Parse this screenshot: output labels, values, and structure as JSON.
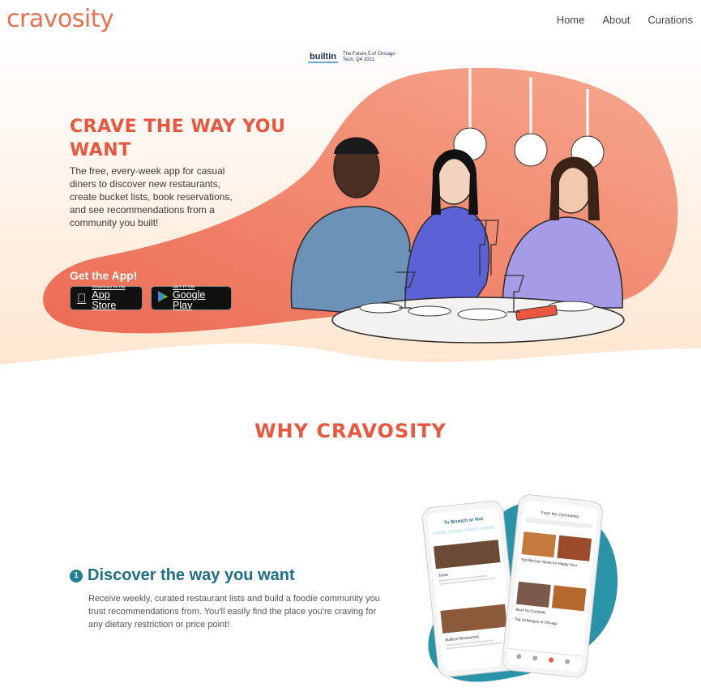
{
  "header": {
    "logo": "cravosity",
    "nav": [
      "Home",
      "About",
      "Curations"
    ]
  },
  "award": {
    "logo": "builtin",
    "text": "The Future 5 of Chicago Tech, Q4 2021"
  },
  "hero": {
    "title": "CRAVE THE WAY YOU WANT",
    "description": "The free, every-week app for casual diners to discover new restaurants, create bucket lists, book reservations, and see recommendations from a community you built!",
    "get_app": "Get the App!",
    "app_store": {
      "small": "Download on the",
      "big": "App Store"
    },
    "google_play": {
      "small": "GET IT ON",
      "big": "Google Play"
    }
  },
  "why": {
    "title": "WHY CRAVOSITY",
    "feature": {
      "number": "1",
      "title": "Discover the way you want",
      "description": "Receive weekly, curated restaurant lists and build a foodie community you trust recommendations from. You'll easily find the place you're craving for any dietary restriction or price point!"
    }
  },
  "phones": {
    "left_title": "To Brunch or Not",
    "right_title": "From the Community",
    "right_card_1": "Top Mexican Spots for Happy Hour",
    "right_card_2": "Must Try Cocktails",
    "right_card_3": "Top 10 Burgers in Chicago",
    "left_item_1": "Tanta",
    "left_item_2": "Mallers Restaurant"
  },
  "colors": {
    "brand": "#e9573f",
    "teal": "#1f6f86",
    "blob": "#f08c73"
  }
}
